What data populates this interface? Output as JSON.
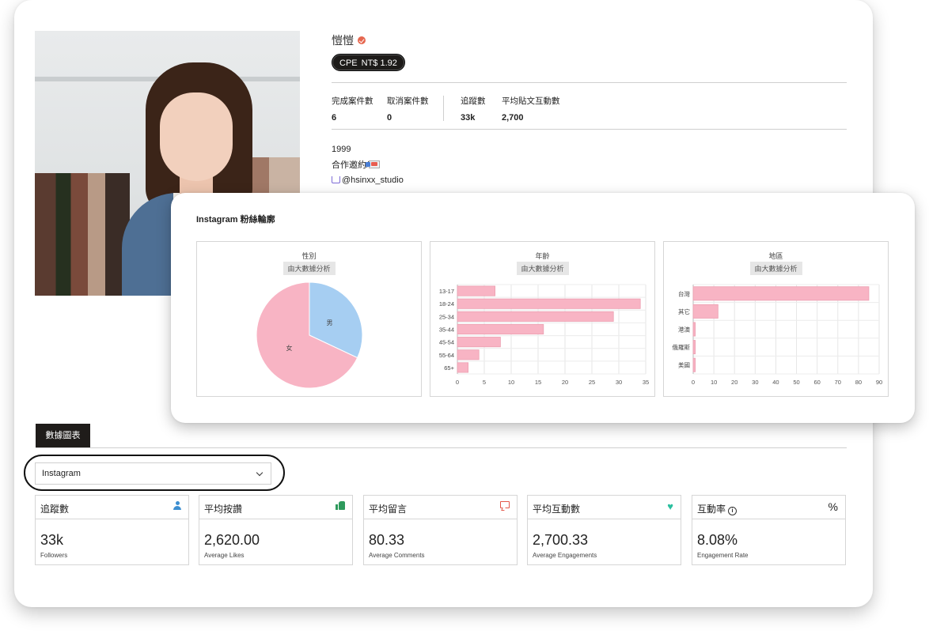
{
  "profile": {
    "name": "愷愷",
    "cpe_label": "CPE",
    "cpe_value": "NT$ 1.92",
    "stats": [
      {
        "label": "完成案件數",
        "value": "6"
      },
      {
        "label": "取消案件數",
        "value": "0"
      },
      {
        "label": "追蹤數",
        "value": "33k"
      },
      {
        "label": "平均貼文互動數",
        "value": "2,700"
      }
    ],
    "bio": {
      "line1": "1999",
      "line2": "合作邀約/",
      "line3": "@hsinxx_studio"
    }
  },
  "charts_section": {
    "title": "Instagram 粉絲輪廓",
    "badge": "由大數據分析"
  },
  "chart_data": [
    {
      "type": "pie",
      "title": "性別",
      "categories": [
        "男",
        "女"
      ],
      "values": [
        32,
        68
      ],
      "colors": [
        "#a6cef2",
        "#f8b4c4"
      ]
    },
    {
      "type": "bar",
      "orientation": "horizontal",
      "title": "年齡",
      "categories": [
        "13-17",
        "18-24",
        "25-34",
        "35-44",
        "45-54",
        "55-64",
        "65+"
      ],
      "values": [
        7,
        34,
        29,
        16,
        8,
        4,
        2
      ],
      "xlim": [
        0,
        35
      ],
      "xticks": [
        0,
        5,
        10,
        15,
        20,
        25,
        30,
        35
      ],
      "grid": true,
      "color": "#f8b4c4"
    },
    {
      "type": "bar",
      "orientation": "horizontal",
      "title": "地區",
      "categories": [
        "台灣",
        "其它",
        "港澳",
        "俄羅斯",
        "美國"
      ],
      "values": [
        85,
        12,
        1,
        1,
        1
      ],
      "xlim": [
        0,
        90
      ],
      "xticks": [
        0,
        10,
        20,
        30,
        40,
        50,
        60,
        70,
        80,
        90
      ],
      "grid": true,
      "color": "#f8b4c4"
    }
  ],
  "tabs": {
    "active": "數據圖表"
  },
  "platform_select": {
    "value": "Instagram"
  },
  "metrics": [
    {
      "label": "追蹤數",
      "value": "33k",
      "sub": "Followers",
      "icon": "user-icon"
    },
    {
      "label": "平均按讚",
      "value": "2,620.00",
      "sub": "Average Likes",
      "icon": "thumbs-up-icon"
    },
    {
      "label": "平均留言",
      "value": "80.33",
      "sub": "Average Comments",
      "icon": "comment-icon"
    },
    {
      "label": "平均互動數",
      "value": "2,700.33",
      "sub": "Average Engagements",
      "icon": "heart-icon"
    },
    {
      "label": "互動率",
      "value": "8.08%",
      "sub": "Engagement Rate",
      "icon": "percent-icon",
      "info_icon": "i"
    }
  ]
}
